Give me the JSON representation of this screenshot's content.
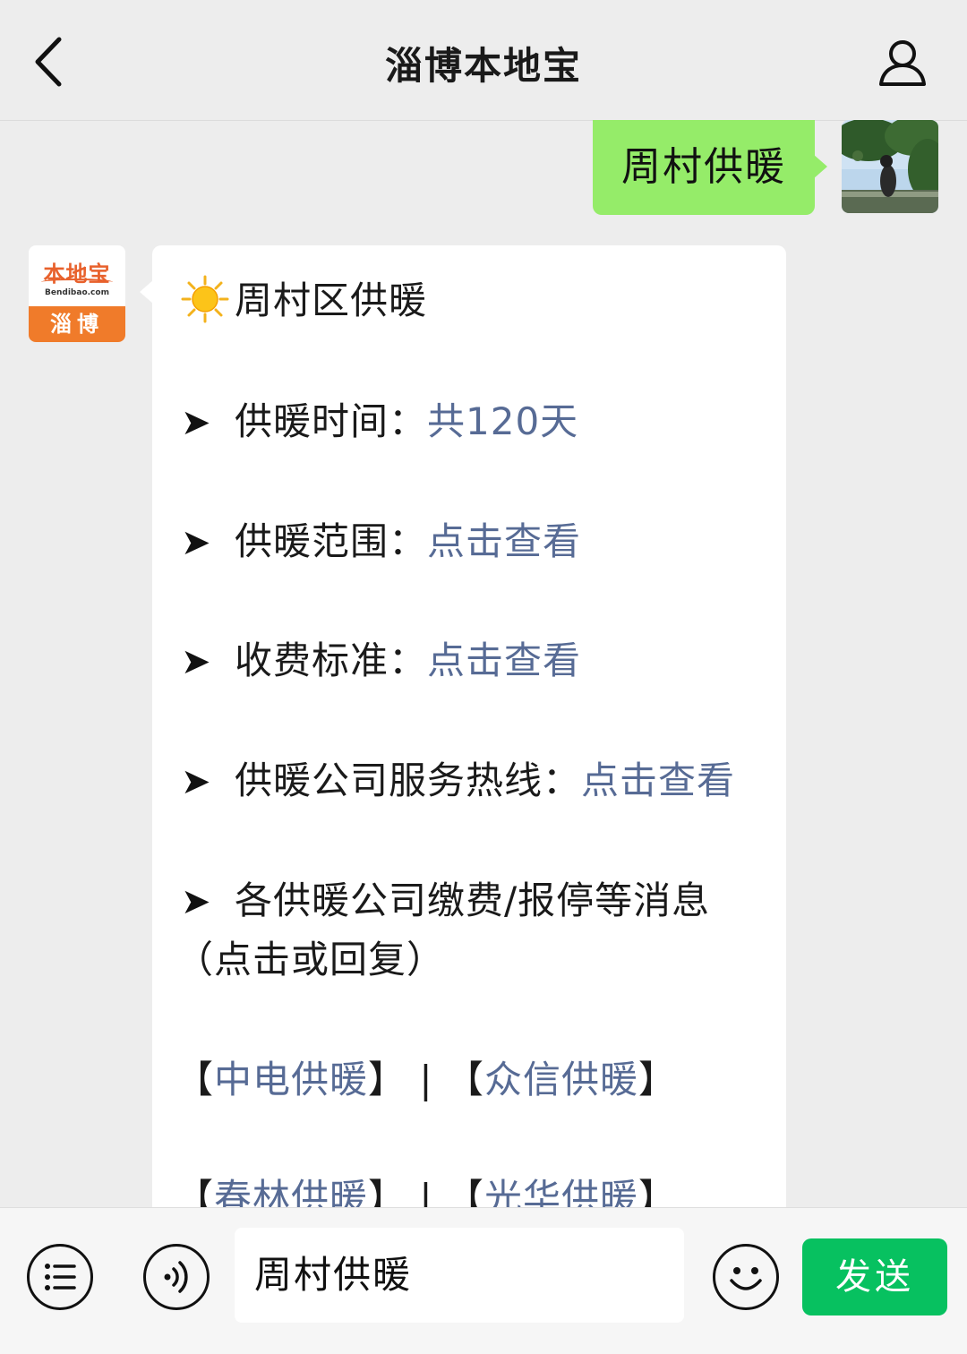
{
  "header": {
    "title": "淄博本地宝"
  },
  "messages": {
    "user_message": "周村供暖",
    "bot_avatar": {
      "logo_text": "本地宝",
      "domain": "Bendibao.com",
      "city": "淄博"
    },
    "bot_message": {
      "heading": "周村区供暖",
      "rows": [
        {
          "label": "供暖时间：",
          "value": "共120天"
        },
        {
          "label": "供暖范围：",
          "value": "点击查看"
        },
        {
          "label": "收费标准：",
          "value": "点击查看"
        },
        {
          "label": "供暖公司服务热线：",
          "value": "点击查看"
        },
        {
          "label": "各供暖公司缴费/报停等消息",
          "value": "（点击或回复）"
        }
      ],
      "companies_row1": {
        "a": "中电供暖",
        "b": "众信供暖"
      },
      "companies_row2": {
        "a": "春林供暖",
        "b": "光华供暖"
      },
      "arrow": "➤",
      "separator": "|",
      "bracket_open": "【",
      "bracket_close": "】"
    }
  },
  "input": {
    "value": "周村供暖",
    "send_label": "发送"
  },
  "colors": {
    "accent_green": "#07c160",
    "bubble_green": "#95ec69",
    "link_blue": "#576b95"
  }
}
